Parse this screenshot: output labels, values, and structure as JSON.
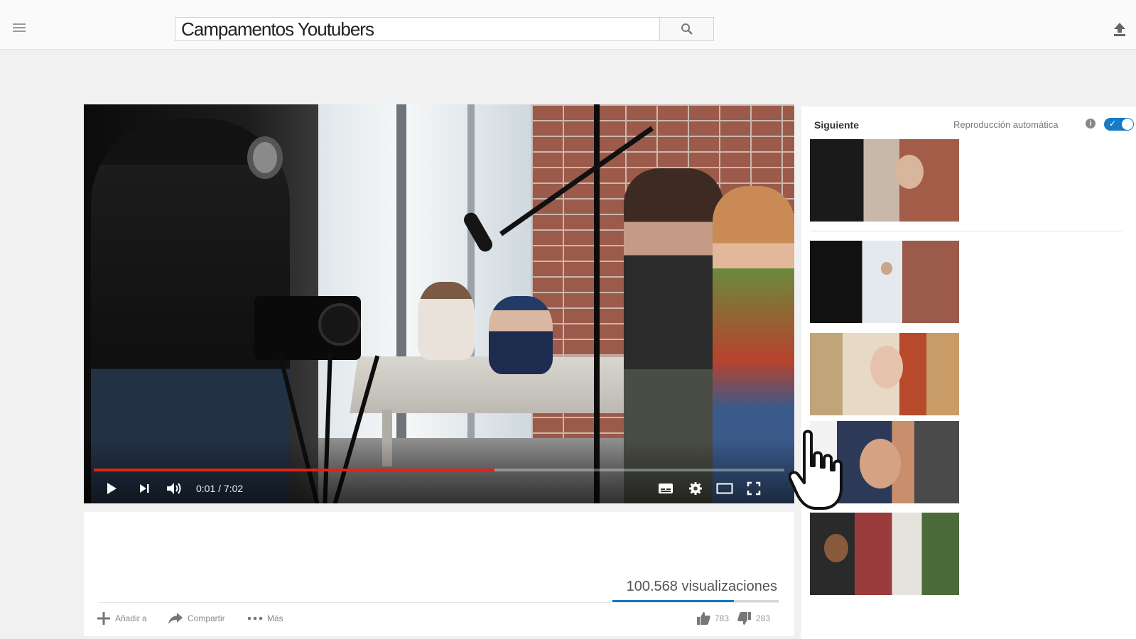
{
  "header": {
    "search_value": "Campamentos Youtubers",
    "icons": {
      "menu": "hamburger-menu-icon",
      "search": "magnifier-icon",
      "upload": "upload-arrow-icon"
    }
  },
  "player": {
    "time": "0:01 / 7:02",
    "progress_fraction": 0.58,
    "icons": [
      "play-icon",
      "next-icon",
      "volume-icon",
      "subtitles-icon",
      "settings-gear-icon",
      "theater-mode-icon",
      "fullscreen-icon"
    ],
    "colors": {
      "progress": "#e62117"
    }
  },
  "info": {
    "views": "100.568 visualizaciones",
    "actions": {
      "add": "Añadir a",
      "share": "Compartir",
      "more": "Más"
    },
    "likes": "783",
    "dislikes": "283",
    "like_fraction": 0.73,
    "colors": {
      "like_bar": "#167ac6"
    }
  },
  "sidebar": {
    "up_next": "Siguiente",
    "autoplay_label": "Reproducción automática",
    "autoplay_on": true,
    "thumbnails": [
      "thumb-1",
      "thumb-2",
      "thumb-3",
      "thumb-4",
      "thumb-5"
    ]
  }
}
